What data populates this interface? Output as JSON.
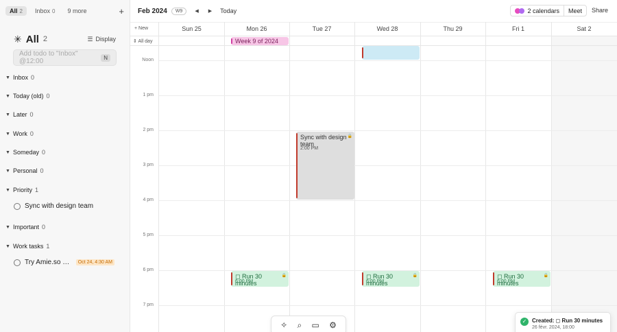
{
  "sidebar": {
    "tabs": [
      {
        "label": "All",
        "count": "2"
      },
      {
        "label": "Inbox",
        "count": "0"
      },
      {
        "label": "9 more"
      }
    ],
    "heading": {
      "title": "All",
      "count": "2",
      "display_label": "Display"
    },
    "add_todo": {
      "placeholder": "Add todo to \"Inbox\" @12:00",
      "shortcut": "N"
    },
    "groups": [
      {
        "label": "Inbox",
        "count": "0"
      },
      {
        "label": "Today (old)",
        "count": "0"
      },
      {
        "label": "Later",
        "count": "0"
      },
      {
        "label": "Work",
        "count": "0"
      },
      {
        "label": "Someday",
        "count": "0"
      },
      {
        "label": "Personal",
        "count": "0"
      },
      {
        "label": "Priority",
        "count": "1"
      },
      {
        "label": "Important",
        "count": "0"
      },
      {
        "label": "Work tasks",
        "count": "1"
      }
    ],
    "todos": [
      {
        "text": "Sync with design team"
      },
      {
        "text": "Try Amie.so calendar",
        "due": "Oct 24, 4:30 AM"
      }
    ]
  },
  "calendar": {
    "month": "Feb 2024",
    "week_badge": "W9",
    "today_label": "Today",
    "calendars_label": "2 calendars",
    "meet_label": "Meet",
    "share_label": "Share",
    "new_label": "New",
    "allday_label": "All day",
    "days": [
      {
        "label": "Sun 25"
      },
      {
        "label": "Mon 26"
      },
      {
        "label": "Tue 27"
      },
      {
        "label": "Wed 28"
      },
      {
        "label": "Thu 29"
      },
      {
        "label": "Fri  1"
      },
      {
        "label": "Sat  2"
      }
    ],
    "times": [
      "Noon",
      "1 pm",
      "2 pm",
      "3 pm",
      "4 pm",
      "5 pm",
      "6 pm",
      "7 pm"
    ],
    "allday_event": {
      "title": "Week 9 of 2024"
    },
    "events": [
      {
        "title": "Sync with design team",
        "time": "2:00 PM"
      },
      {
        "title": "◻ Run 30 minutes",
        "time": "6:00 PM"
      },
      {
        "title": "◻ Run 30 minutes",
        "time": "6:00 PM"
      },
      {
        "title": "◻ Run 30 minutes",
        "time": "6:00 PM"
      }
    ],
    "colors": {
      "pink": "#f7c6e6",
      "cyan": "#cdeaf5",
      "gray": "#d9d9d9",
      "green": "#d2f2de",
      "red": "#c0392b"
    }
  },
  "toast": {
    "title": "Created: ◻ Run 30 minutes",
    "subtitle": "26 févr. 2024, 18:00"
  }
}
